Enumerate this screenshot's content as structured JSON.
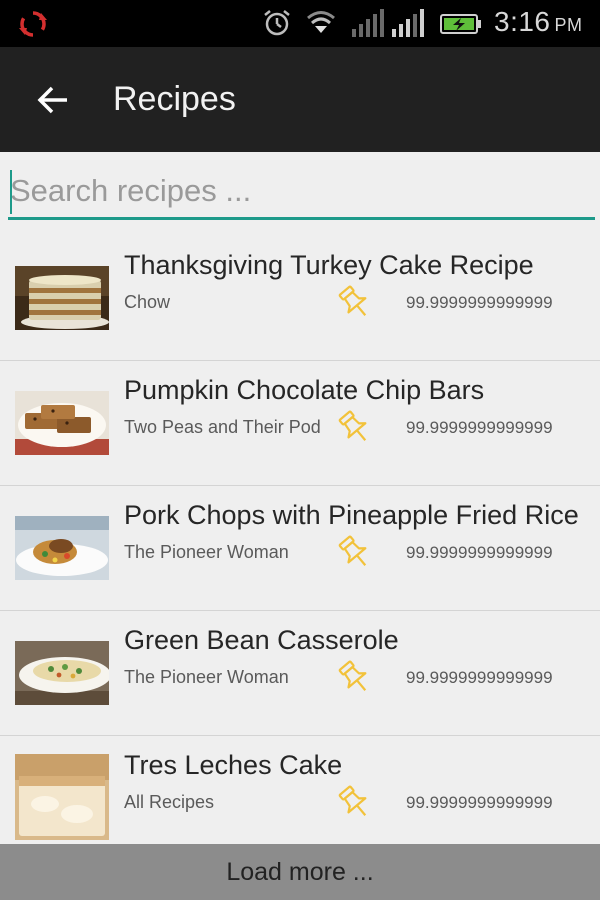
{
  "status_bar": {
    "time": "3:16",
    "ampm": "PM",
    "icons": [
      "sync-icon",
      "alarm-icon",
      "wifi-icon",
      "signal-icon",
      "signal-icon",
      "battery-charging-icon"
    ],
    "sync_color": "#d32f2f",
    "battery_color": "#5fbf3a"
  },
  "app_bar": {
    "title": "Recipes",
    "back_icon": "arrow-left-icon"
  },
  "search": {
    "placeholder": "Search recipes ...",
    "value": "",
    "accent_color": "#1d9a8a"
  },
  "recipes": [
    {
      "title": "Thanksgiving Turkey Cake Recipe",
      "source": "Chow",
      "score": "99.9999999999999",
      "thumb_icon": "layer-cake-photo"
    },
    {
      "title": "Pumpkin Chocolate Chip Bars",
      "source": "Two Peas and Their Pod",
      "score": "99.9999999999999",
      "thumb_icon": "dessert-bars-photo"
    },
    {
      "title": "Pork Chops with Pineapple Fried Rice",
      "source": "The Pioneer Woman",
      "score": "99.9999999999999",
      "thumb_icon": "plated-dish-photo"
    },
    {
      "title": "Green Bean Casserole",
      "source": "The Pioneer Woman",
      "score": "99.9999999999999",
      "thumb_icon": "casserole-photo"
    },
    {
      "title": "Tres Leches Cake",
      "source": "All Recipes",
      "score": "99.9999999999999",
      "thumb_icon": "sheet-cake-photo"
    }
  ],
  "pin_icon": "pushpin-icon",
  "pin_color": "#f2c23a",
  "load_more_label": "Load more ..."
}
